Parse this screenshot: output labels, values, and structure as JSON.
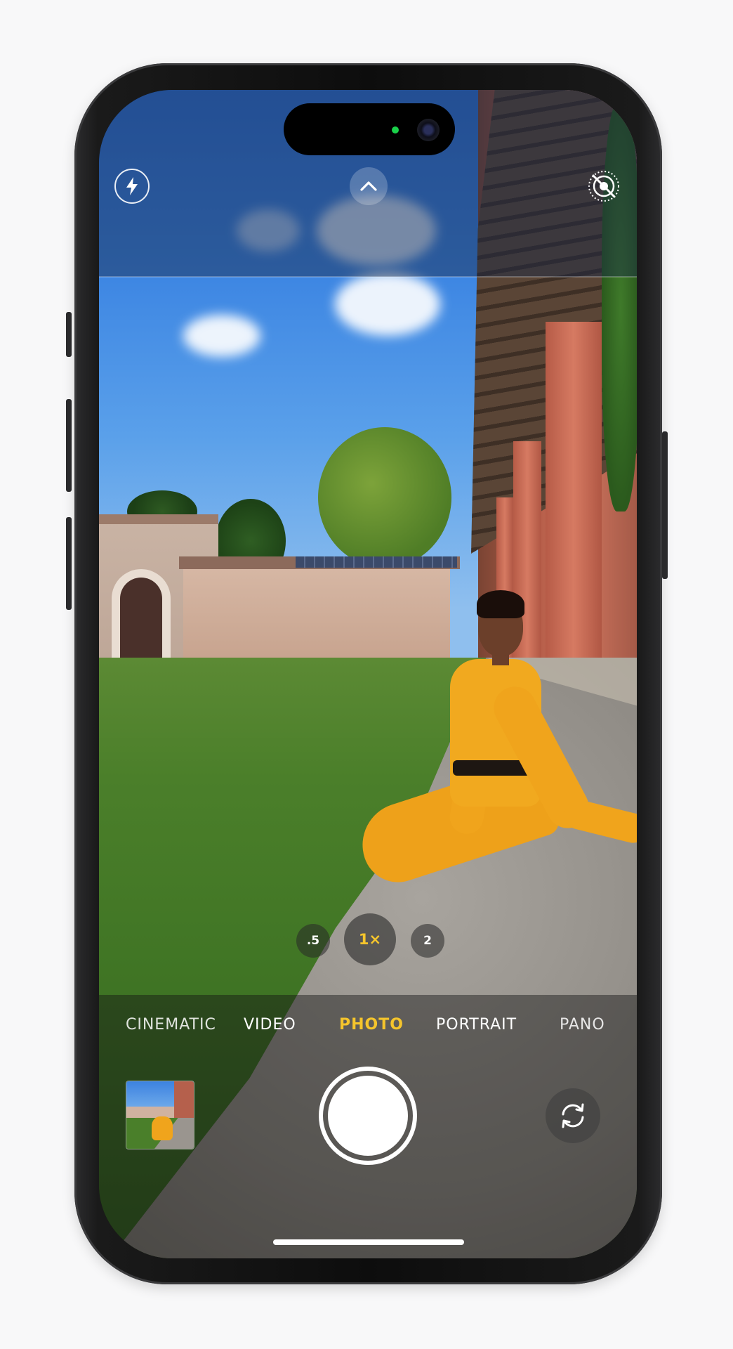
{
  "camera": {
    "zoom_levels": [
      ".5",
      "1×",
      "2"
    ],
    "selected_zoom": "1×",
    "modes": [
      "CINEMATIC",
      "VIDEO",
      "PHOTO",
      "PORTRAIT",
      "PANO"
    ],
    "selected_mode": "PHOTO",
    "icons": {
      "flash": "flash-icon",
      "controls": "chevron-up-icon",
      "live_photo": "live-photo-off-icon",
      "flip": "camera-flip-icon",
      "shutter": "shutter-button"
    }
  },
  "colors": {
    "accent": "#f5c52c",
    "island_indicator": "#1ad14a"
  }
}
